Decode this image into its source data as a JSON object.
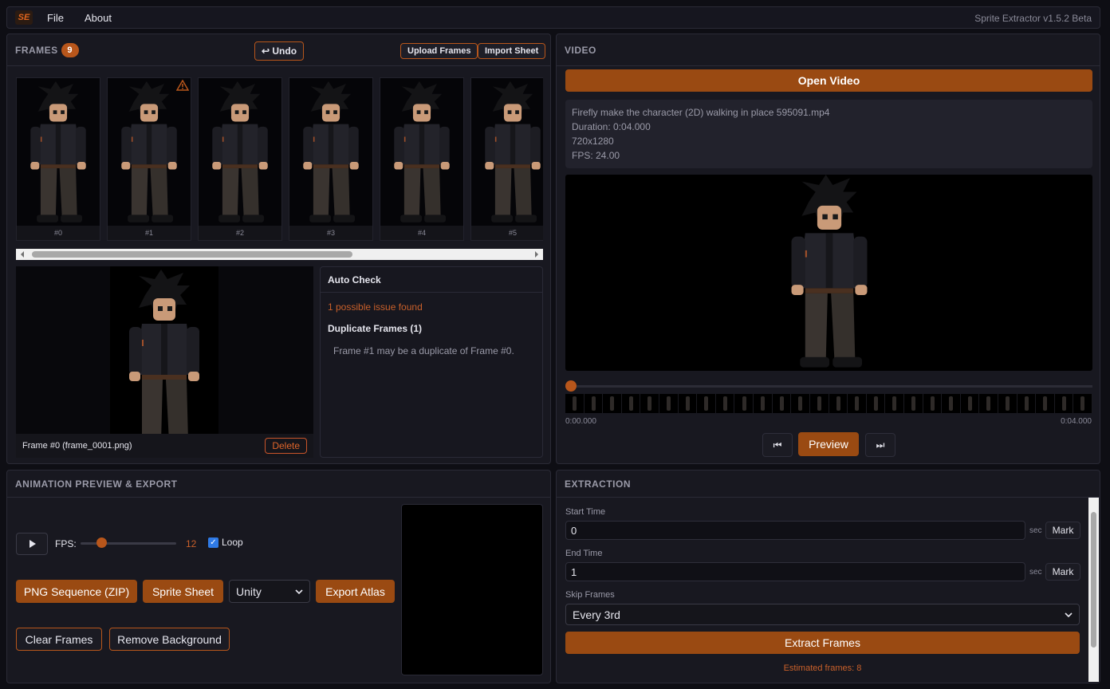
{
  "menu": {
    "logo": "SE",
    "items": [
      "File",
      "About"
    ],
    "app_title": "Sprite Extractor v1.5.2 Beta"
  },
  "frames": {
    "title": "FRAMES",
    "count": "9",
    "undo": "↩ Undo",
    "upload": "Upload Frames",
    "import": "Import Sheet",
    "thumbs": [
      "#0",
      "#1",
      "#2",
      "#3",
      "#4",
      "#5"
    ],
    "selected_caption": "Frame #0 (frame_0001.png)",
    "delete": "Delete"
  },
  "autocheck": {
    "title": "Auto Check",
    "summary": "1 possible issue found",
    "issue_title": "Duplicate Frames (1)",
    "issue_desc": "Frame #1 may be a duplicate of Frame #0."
  },
  "video": {
    "title": "VIDEO",
    "open": "Open Video",
    "file": "Firefly make the character (2D) walking in place 595091.mp4",
    "duration": "Duration: 0:04.000",
    "resolution": "720x1280",
    "fps": "FPS: 24.00",
    "time_start": "0:00.000",
    "time_end": "0:04.000",
    "preview": "Preview",
    "prev_icon": "⏮",
    "next_icon": "⏭",
    "position_fraction": 0
  },
  "animation": {
    "title": "ANIMATION PREVIEW & EXPORT",
    "fps_label": "FPS:",
    "fps_value": "12",
    "loop_label": "Loop",
    "png_seq": "PNG Sequence (ZIP)",
    "sprite_sheet": "Sprite Sheet",
    "engine": "Unity",
    "export_atlas": "Export Atlas",
    "clear": "Clear Frames",
    "remove_bg": "Remove Background"
  },
  "extraction": {
    "title": "EXTRACTION",
    "start_label": "Start Time",
    "start_value": "0",
    "end_label": "End Time",
    "end_value": "1",
    "sec": "sec",
    "mark": "Mark",
    "skip_label": "Skip Frames",
    "skip_value": "Every 3rd",
    "extract": "Extract Frames",
    "estimate": "Estimated frames: 8"
  },
  "colors": {
    "accent": "#9a4a12",
    "accent_light": "#c9602a",
    "bg": "#0e0e14",
    "panel": "#181820"
  }
}
